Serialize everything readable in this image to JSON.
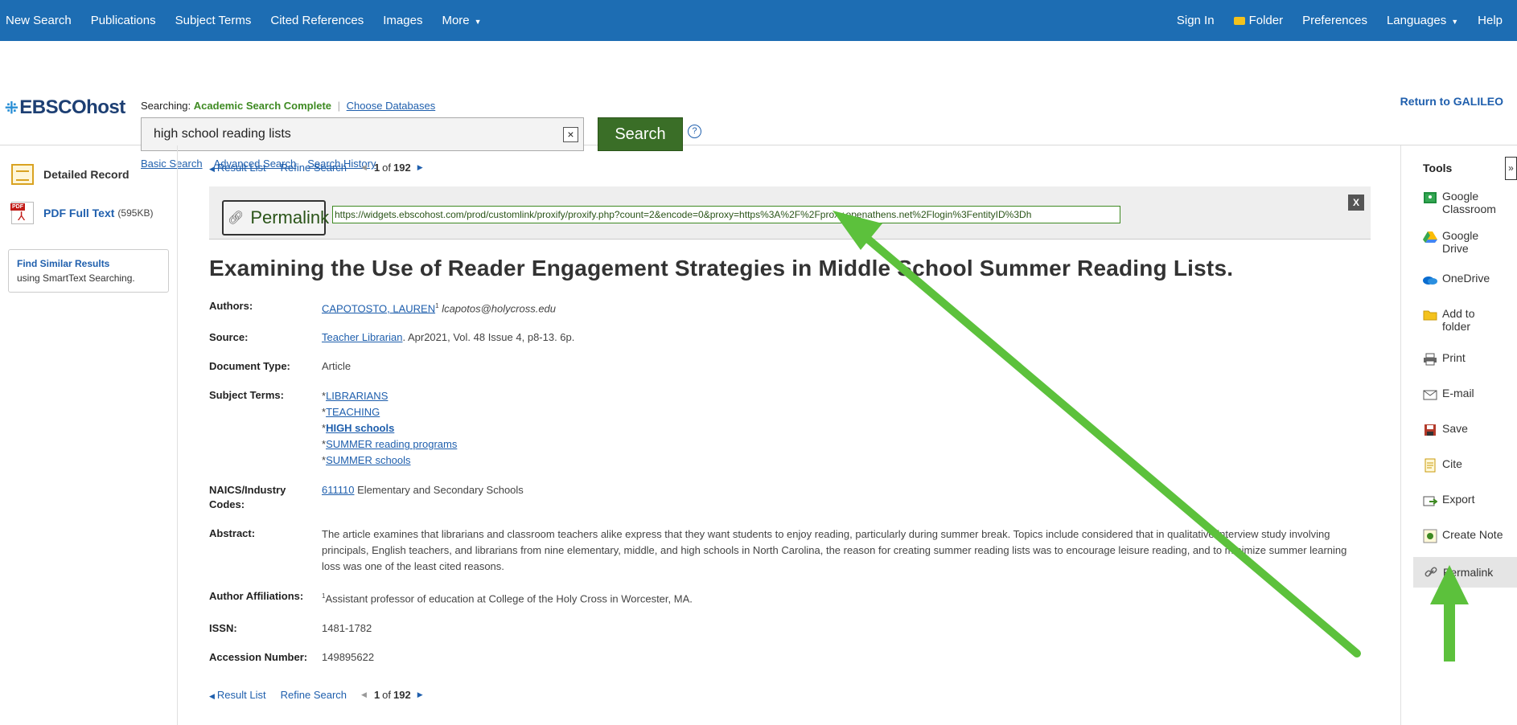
{
  "topnav": {
    "left": [
      "New Search",
      "Publications",
      "Subject Terms",
      "Cited References",
      "Images",
      "More"
    ],
    "right": {
      "signin": "Sign In",
      "folder": "Folder",
      "preferences": "Preferences",
      "languages": "Languages",
      "help": "Help"
    }
  },
  "header": {
    "logo": "EBSCOhost",
    "searching_label": "Searching:",
    "database": "Academic Search Complete",
    "choose_databases": "Choose Databases",
    "query": "high school reading lists",
    "search_button": "Search",
    "help": "?",
    "links": [
      "Basic Search",
      "Advanced Search",
      "Search History"
    ],
    "return_link": "Return to GALILEO"
  },
  "left": {
    "detailed_record": "Detailed Record",
    "pdf_label": "PDF Full Text",
    "pdf_size": "(595KB)",
    "similar_title": "Find Similar Results",
    "similar_sub": "using SmartText Searching."
  },
  "nav": {
    "result_list": "Result List",
    "refine_search": "Refine Search",
    "position": "1",
    "of": "of",
    "total": "192"
  },
  "permalink": {
    "title": "Permalink",
    "url": "https://widgets.ebscohost.com/prod/customlink/proxify/proxify.php?count=2&encode=0&proxy=https%3A%2F%2Fproxy.openathens.net%2Flogin%3FentityID%3Dh",
    "close": "X"
  },
  "record": {
    "title": "Examining the Use of Reader Engagement Strategies in Middle School Summer Reading Lists.",
    "labels": {
      "authors": "Authors:",
      "source": "Source:",
      "doctype": "Document Type:",
      "subjects": "Subject Terms:",
      "naics": "NAICS/Industry Codes:",
      "abstract": "Abstract:",
      "affiliations": "Author Affiliations:",
      "issn": "ISSN:",
      "accession": "Accession Number:"
    },
    "author_name": "CAPOTOSTO, LAUREN",
    "author_sup": "1",
    "author_email": "lcapotos@holycross.edu",
    "source_journal": "Teacher Librarian",
    "source_rest": ". Apr2021, Vol. 48 Issue 4, p8-13. 6p.",
    "doctype": "Article",
    "subjects": [
      "LIBRARIANS",
      "TEACHING",
      "HIGH schools",
      "SUMMER reading programs",
      "SUMMER schools"
    ],
    "naics_code": "611110",
    "naics_text": "Elementary and Secondary Schools",
    "abstract": "The article examines that librarians and classroom teachers alike express that they want students to enjoy reading, particularly during summer break. Topics include considered that in qualitative interview study involving principals, English teachers, and librarians from nine elementary, middle, and high schools in North Carolina, the reason for creating summer reading lists was to encourage leisure reading, and to minimize summer learning loss was one of the least cited reasons.",
    "affiliation_sup": "1",
    "affiliation": "Assistant professor of education at College of the Holy Cross in Worcester, MA.",
    "issn": "1481-1782",
    "accession": "149895622"
  },
  "tools": {
    "heading": "Tools",
    "collapse": "»",
    "items": [
      {
        "label": "Google Classroom",
        "icon": "google-classroom-icon"
      },
      {
        "label": "Google Drive",
        "icon": "google-drive-icon"
      },
      {
        "label": "OneDrive",
        "icon": "onedrive-icon"
      },
      {
        "label": "Add to folder",
        "icon": "folder-icon"
      },
      {
        "label": "Print",
        "icon": "print-icon"
      },
      {
        "label": "E-mail",
        "icon": "email-icon"
      },
      {
        "label": "Save",
        "icon": "save-icon"
      },
      {
        "label": "Cite",
        "icon": "cite-icon"
      },
      {
        "label": "Export",
        "icon": "export-icon"
      },
      {
        "label": "Create Note",
        "icon": "note-icon"
      },
      {
        "label": "Permalink",
        "icon": "chain-link-icon"
      }
    ]
  },
  "colors": {
    "topbar": "#1d6db3",
    "search_button": "#3a6e27",
    "link": "#1f5fad",
    "annotation_arrow": "#5cc13c"
  }
}
